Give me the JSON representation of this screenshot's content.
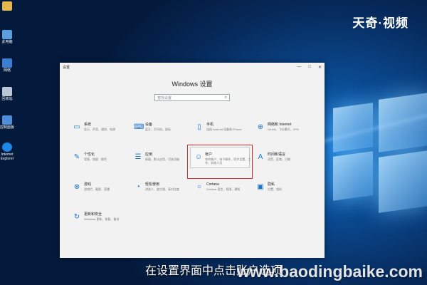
{
  "window": {
    "titlebar_label": "设置",
    "title": "Windows 设置",
    "controls": {
      "minimize": "—",
      "maximize": "□",
      "close": "✕"
    }
  },
  "search": {
    "placeholder": "查找设置"
  },
  "tiles": [
    {
      "name": "系统",
      "desc": "显示、声音、通知、电源",
      "icon": "laptop-icon"
    },
    {
      "name": "设备",
      "desc": "蓝牙、打印机、鼠标",
      "icon": "keyboard-icon"
    },
    {
      "name": "手机",
      "desc": "连接 Android 设备和 iPhone",
      "icon": "phone-icon"
    },
    {
      "name": "网络和 Internet",
      "desc": "WLAN、飞行模式、VPN",
      "icon": "globe-icon"
    },
    {
      "name": "个性化",
      "desc": "背景、锁屏、颜色",
      "icon": "brush-icon"
    },
    {
      "name": "应用",
      "desc": "卸载、默认应用、可选功能",
      "icon": "apps-list-icon"
    },
    {
      "name": "帐户",
      "desc": "你的帐户、电子邮件、同步设置、工作、其他人员",
      "icon": "person-icon"
    },
    {
      "name": "时间和语言",
      "desc": "语音、区域、日期",
      "icon": "time-language-icon"
    },
    {
      "name": "游戏",
      "desc": "游戏栏、截屏、直播",
      "icon": "xbox-icon"
    },
    {
      "name": "轻松使用",
      "desc": "讲述人、放大镜、高对比度",
      "icon": "ease-of-access-icon"
    },
    {
      "name": "Cortana",
      "desc": "Cortana 语言、权限、通知",
      "icon": "cortana-icon"
    },
    {
      "name": "隐私",
      "desc": "位置、相机",
      "icon": "lock-icon"
    },
    {
      "name": "更新和安全",
      "desc": "Windows 更新、恢复、备份",
      "icon": "refresh-icon"
    }
  ],
  "desktop_icons": [
    {
      "label": ""
    },
    {
      "label": "此电脑"
    },
    {
      "label": "网络"
    },
    {
      "label": "回收站"
    },
    {
      "label": "控制面板"
    },
    {
      "label": "Internet Explorer"
    }
  ],
  "watermark_top": "天奇·视频",
  "subtitle": "在设置界面中点击账户选项",
  "watermark_bottom": "www.baodingbaike.com",
  "colors": {
    "accent": "#1a73c9",
    "highlight": "#d12b2b"
  }
}
